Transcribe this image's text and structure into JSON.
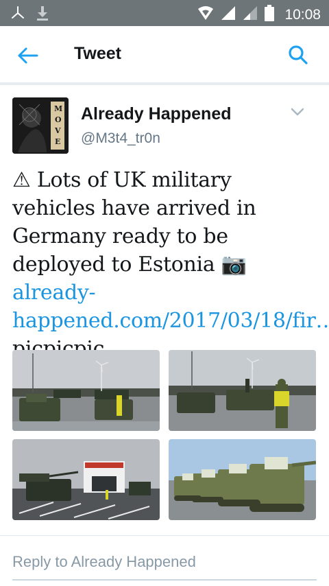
{
  "status_bar": {
    "time": "10:08",
    "icons": [
      "app-notification-icon",
      "download-icon",
      "hotspot-icon",
      "signal-icon",
      "signal-icon",
      "battery-icon"
    ]
  },
  "app_bar": {
    "title": "Tweet",
    "back_icon": "arrow-left-icon",
    "search_icon": "search-icon"
  },
  "tweet": {
    "author_name": "Already Happened",
    "author_handle": "@M3t4_tr0n",
    "text_prefix": "⚠ Lots of UK military vehicles have arrived in Germany ready to be deployed to Estonia 📷 ",
    "link_text": "already-happened.com/2017/03/18/fir…",
    "text_suffix": "picpicpic",
    "avatar_text": "MOVE"
  },
  "reply": {
    "placeholder": "Reply to Already Happened"
  },
  "colors": {
    "status_bar": "#6e7579",
    "accent": "#1b95e0",
    "text": "#14171a",
    "secondary_text": "#657786"
  }
}
